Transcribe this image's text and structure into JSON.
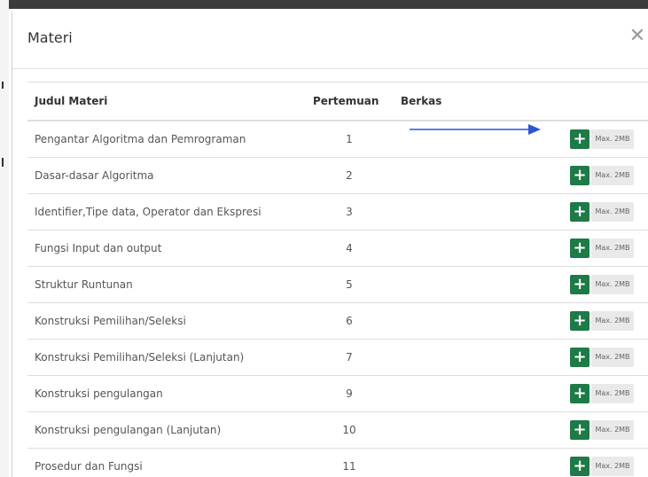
{
  "modal": {
    "title": "Materi",
    "close_icon": "close-icon"
  },
  "table": {
    "headers": {
      "judul": "Judul Materi",
      "pertemuan": "Pertemuan",
      "berkas": "Berkas"
    },
    "rows": [
      {
        "judul": "Pengantar Algoritma dan Pemrograman",
        "pertemuan": "1"
      },
      {
        "judul": "Dasar-dasar Algoritma",
        "pertemuan": "2"
      },
      {
        "judul": "Identifier,Tipe data, Operator dan Ekspresi",
        "pertemuan": "3"
      },
      {
        "judul": "Fungsi Input dan output",
        "pertemuan": "4"
      },
      {
        "judul": "Struktur Runtunan",
        "pertemuan": "5"
      },
      {
        "judul": "Konstruksi Pemilihan/Seleksi",
        "pertemuan": "6"
      },
      {
        "judul": "Konstruksi Pemilihan/Seleksi (Lanjutan)",
        "pertemuan": "7"
      },
      {
        "judul": "Konstruksi pengulangan",
        "pertemuan": "9"
      },
      {
        "judul": "Konstruksi pengulangan (Lanjutan)",
        "pertemuan": "10"
      },
      {
        "judul": "Prosedur dan Fungsi",
        "pertemuan": "11"
      }
    ]
  },
  "upload": {
    "add_label": "+",
    "max_label": "Max. 2MB"
  },
  "colors": {
    "add_button": "#1e7a46",
    "arrow": "#2b54d6",
    "badge_bg": "#e9e9e9"
  }
}
